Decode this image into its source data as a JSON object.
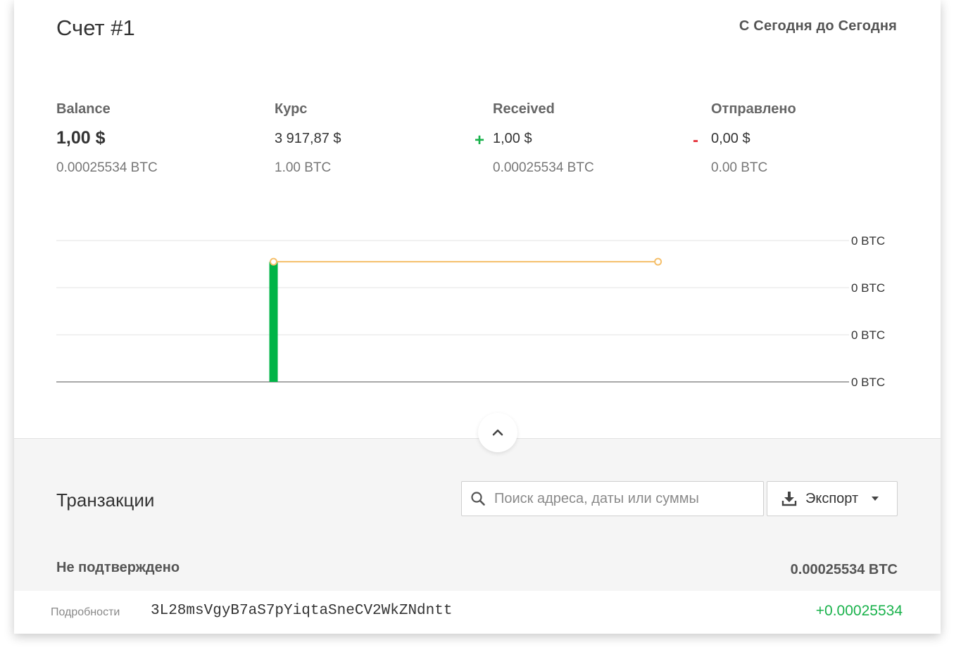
{
  "header": {
    "account_title": "Счет #1",
    "date_range": "С Сегодня до Сегодня"
  },
  "stats": {
    "balance": {
      "label": "Balance",
      "fiat": "1,00 $",
      "btc": "0.00025534 BTC"
    },
    "rate": {
      "label": "Курс",
      "fiat": "3 917,87 $",
      "btc": "1.00 BTC"
    },
    "received": {
      "label": "Received",
      "sign": "+",
      "fiat": "1,00 $",
      "btc": "0.00025534 BTC"
    },
    "sent": {
      "label": "Отправлено",
      "sign": "-",
      "fiat": "0,00 $",
      "btc": "0.00 BTC"
    }
  },
  "chart_data": {
    "type": "bar",
    "y_tick_labels": [
      "0 BTC",
      "0 BTC",
      "0 BTC",
      "0 BTC"
    ],
    "bar": {
      "value_fraction_of_axis": 0.85
    },
    "balance_line": {
      "value_fraction_of_axis": 0.85,
      "extent_fraction_of_timeline": 0.485
    },
    "colors": {
      "bar": "#00b446",
      "line": "#f5bf6a",
      "grid": "#e3e3e3",
      "baseline": "#8c8c8c"
    },
    "grid": true
  },
  "transactions": {
    "title": "Транзакции",
    "search_placeholder": "Поиск адреса, даты или суммы",
    "export_label": "Экспорт",
    "groups": [
      {
        "status": "Не подтверждено",
        "total": "0.00025534 BTC",
        "rows": [
          {
            "details_label": "Подробности",
            "address": "3L28msVgyB7aS7pYiqtaSneCV2WkZNdntt",
            "amount": "+0.00025534"
          }
        ]
      }
    ]
  },
  "icons": {
    "collapse": "chevron-up-icon",
    "search": "search-icon",
    "export": "download-icon",
    "export_caret": "caret-down-icon"
  },
  "colors": {
    "positive": "#19b24b",
    "negative": "#e5343d"
  }
}
